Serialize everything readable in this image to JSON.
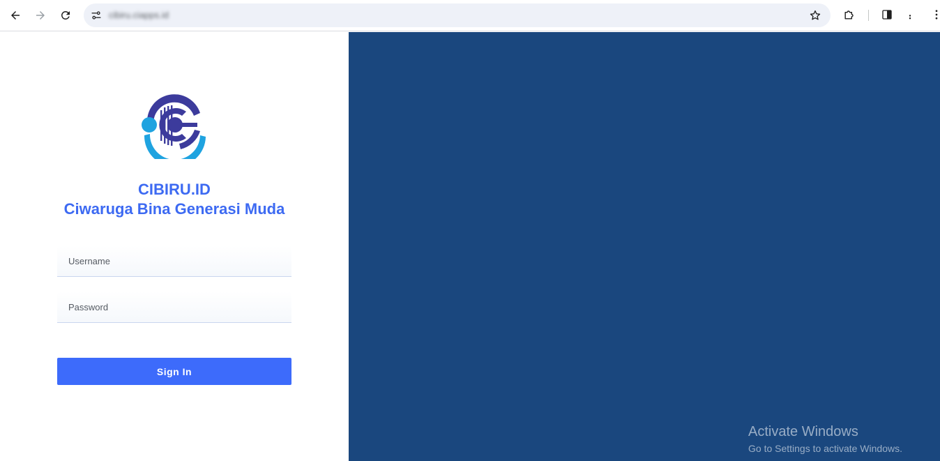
{
  "browser": {
    "url": "cibiru.ciapps.id",
    "icons": {
      "back": "arrow-left-icon",
      "forward": "arrow-right-icon",
      "reload": "reload-icon",
      "site_info": "site-settings-icon",
      "bookmark": "star-icon",
      "extensions": "puzzle-icon",
      "side_panel": "side-panel-icon",
      "profile": "more-dots-icon",
      "menu": "kebab-menu-icon"
    }
  },
  "login": {
    "brand_title": "CIBIRU.ID",
    "brand_subtitle": "Ciwaruga Bina Generasi Muda",
    "username_placeholder": "Username",
    "password_placeholder": "Password",
    "sign_in_label": "Sign In"
  },
  "watermark": {
    "title": "Activate Windows",
    "subtitle": "Go to Settings to activate Windows."
  },
  "colors": {
    "accent": "#3d6af2",
    "button": "#3d6bfb",
    "hero_background": "#1a477e",
    "logo_dark": "#3c3b9c",
    "logo_light": "#1fa3e0"
  }
}
